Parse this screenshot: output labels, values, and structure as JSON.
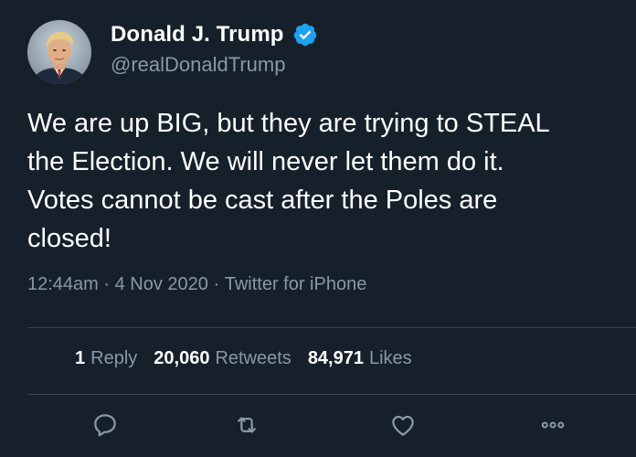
{
  "author": {
    "display_name": "Donald J. Trump",
    "handle": "@realDonaldTrump",
    "verified_badge_icon": "verified-icon",
    "avatar_icon": "avatar-photo"
  },
  "tweet": {
    "text": "We are up BIG, but they are trying to STEAL\nthe Election. We will never let them do it.\nVotes cannot be cast after the Poles are\nclosed!",
    "time": "12:44am",
    "separator": " · ",
    "date": "4 Nov 2020",
    "source": "Twitter for iPhone"
  },
  "stats": {
    "replies_count": "1",
    "replies_label": "Reply",
    "retweets_count": "20,060",
    "retweets_label": "Retweets",
    "likes_count": "84,971",
    "likes_label": "Likes"
  },
  "actions": [
    "reply-icon",
    "retweet-icon",
    "like-icon",
    "more-icon"
  ],
  "colors": {
    "background": "#15202b",
    "text_primary": "#ffffff",
    "text_secondary": "#8899a6",
    "divider": "#38444d",
    "verified": "#1da1f2"
  }
}
